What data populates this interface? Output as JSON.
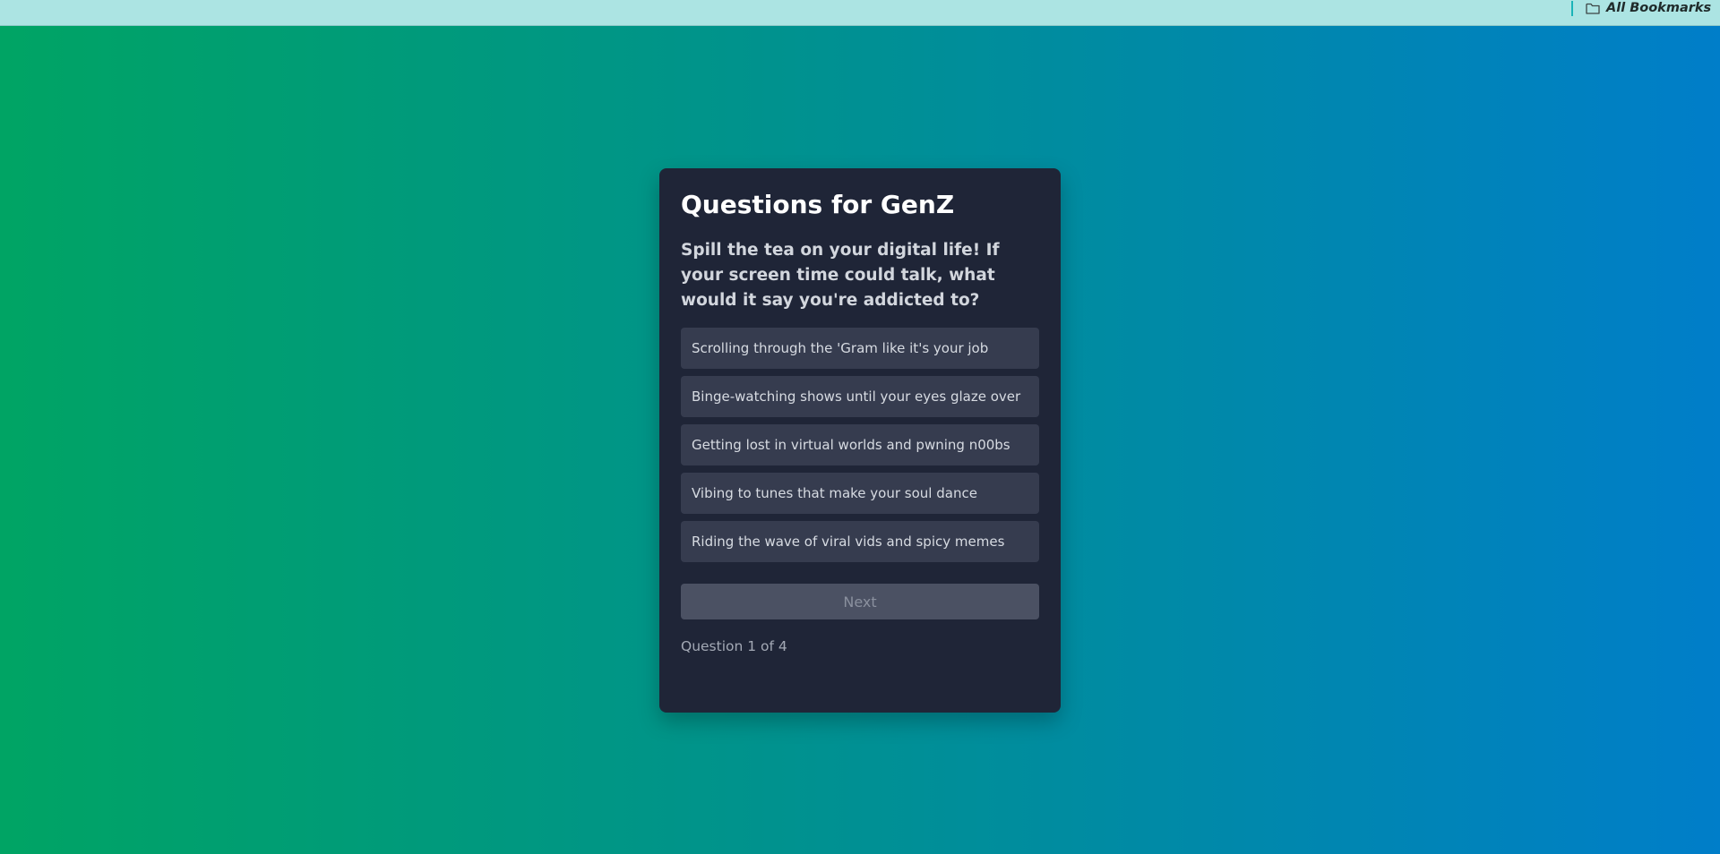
{
  "bookmarks_bar": {
    "folder_label": "All Bookmarks",
    "folder_icon": "folder-icon"
  },
  "quiz": {
    "title": "Questions for GenZ",
    "question": "Spill the tea on your digital life! If your screen time could talk, what would it say you're addicted to?",
    "options": [
      "Scrolling through the 'Gram like it's your job",
      "Binge-watching shows until your eyes glaze over",
      "Getting lost in virtual worlds and pwning n00bs",
      "Vibing to tunes that make your soul dance",
      "Riding the wave of viral vids and spicy memes"
    ],
    "next_label": "Next",
    "progress_text": "Question 1 of 4"
  },
  "colors": {
    "background_gradient": [
      "#00a464",
      "#00928e",
      "#007ec9"
    ],
    "card_background": "#1f2537",
    "option_background": "#363c4f",
    "bookmarks_bar": "#ace4e3"
  }
}
